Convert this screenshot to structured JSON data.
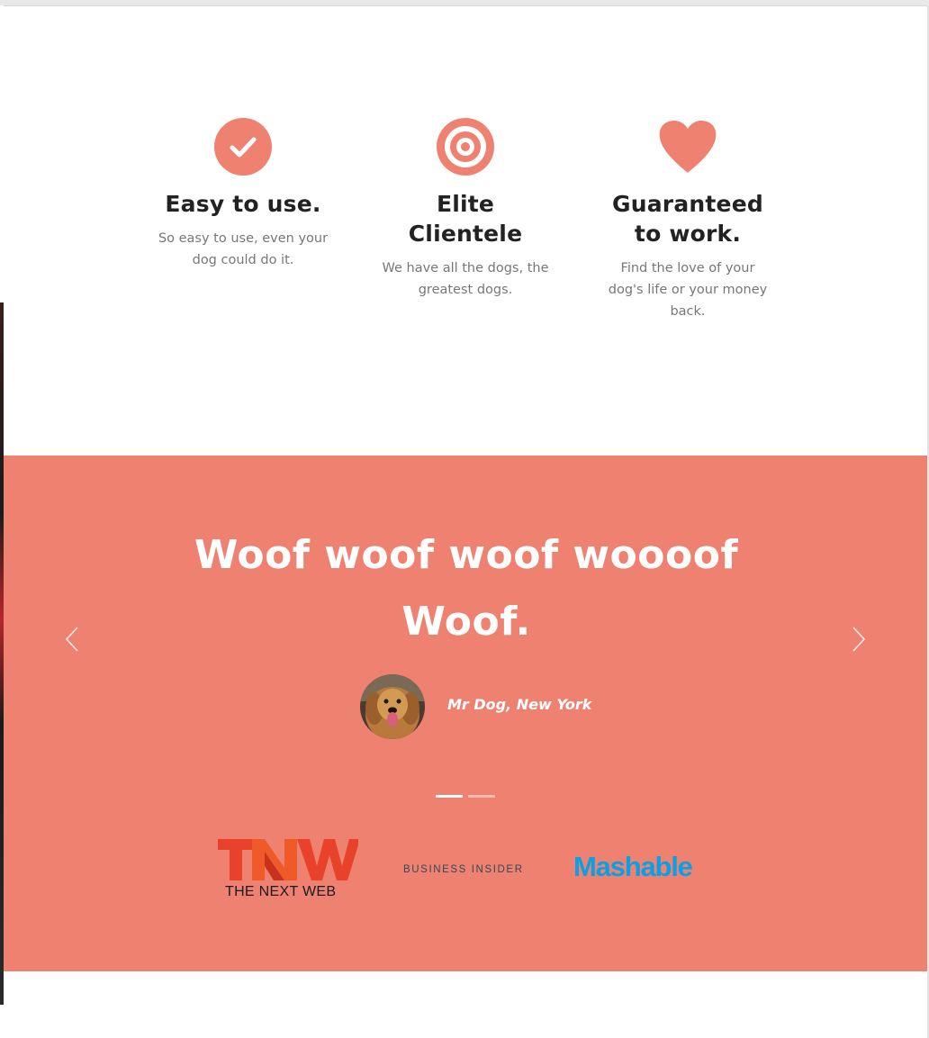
{
  "features": [
    {
      "icon": "check-circle-icon",
      "title": "Easy to use.",
      "text": "So easy to use, even your dog could do it."
    },
    {
      "icon": "target-icon",
      "title": "Elite Clientele",
      "text": "We have all the dogs, the greatest dogs."
    },
    {
      "icon": "heart-icon",
      "title": "Guaranteed to work.",
      "text": "Find the love of your dog's life or your money back."
    }
  ],
  "testimonial": {
    "quote": "Woof woof woof woooof Woof.",
    "author": "Mr Dog, New York",
    "prev_icon": "chevron-left-icon",
    "next_icon": "chevron-right-icon",
    "slide_count": 2,
    "active_slide": 1
  },
  "press": {
    "tnw_mark": "TNW",
    "tnw_label": "THE NEXT WEB",
    "business_insider": "BUSINESS INSIDER",
    "mashable": "Mashable"
  },
  "colors": {
    "accent": "#ef8171",
    "heading": "#222222",
    "body_text": "#777777",
    "tnw": "#e8432a",
    "mashable": "#0aa0e6"
  }
}
